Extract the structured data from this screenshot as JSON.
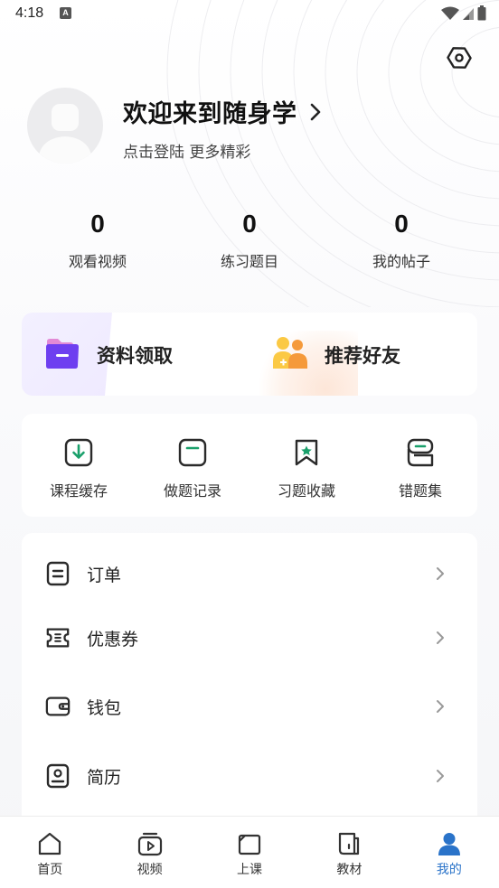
{
  "status_bar": {
    "time": "4:18",
    "badge": "A"
  },
  "profile": {
    "title": "欢迎来到随身学",
    "subtitle": "点击登陆 更多精彩"
  },
  "stats": [
    {
      "value": "0",
      "label": "观看视频"
    },
    {
      "value": "0",
      "label": "练习题目"
    },
    {
      "value": "0",
      "label": "我的帖子"
    }
  ],
  "promo": {
    "left_label": "资料领取",
    "right_label": "推荐好友"
  },
  "tools": [
    {
      "label": "课程缓存",
      "icon": "download-icon"
    },
    {
      "label": "做题记录",
      "icon": "record-icon"
    },
    {
      "label": "习题收藏",
      "icon": "bookmark-star-icon"
    },
    {
      "label": "错题集",
      "icon": "stack-icon"
    }
  ],
  "menu": [
    {
      "label": "订单",
      "icon": "order-icon"
    },
    {
      "label": "优惠券",
      "icon": "coupon-icon"
    },
    {
      "label": "钱包",
      "icon": "wallet-icon"
    },
    {
      "label": "简历",
      "icon": "resume-icon"
    }
  ],
  "tabs": [
    {
      "label": "首页",
      "icon": "home-icon"
    },
    {
      "label": "视频",
      "icon": "video-icon"
    },
    {
      "label": "上课",
      "icon": "class-icon"
    },
    {
      "label": "教材",
      "icon": "book-icon"
    },
    {
      "label": "我的",
      "icon": "profile-icon",
      "active": true
    }
  ],
  "colors": {
    "accent_green": "#1aa06b",
    "tab_active": "#2a73c9",
    "folder_purple": "#6e3ff0",
    "people_orange": "#f59a3b"
  }
}
